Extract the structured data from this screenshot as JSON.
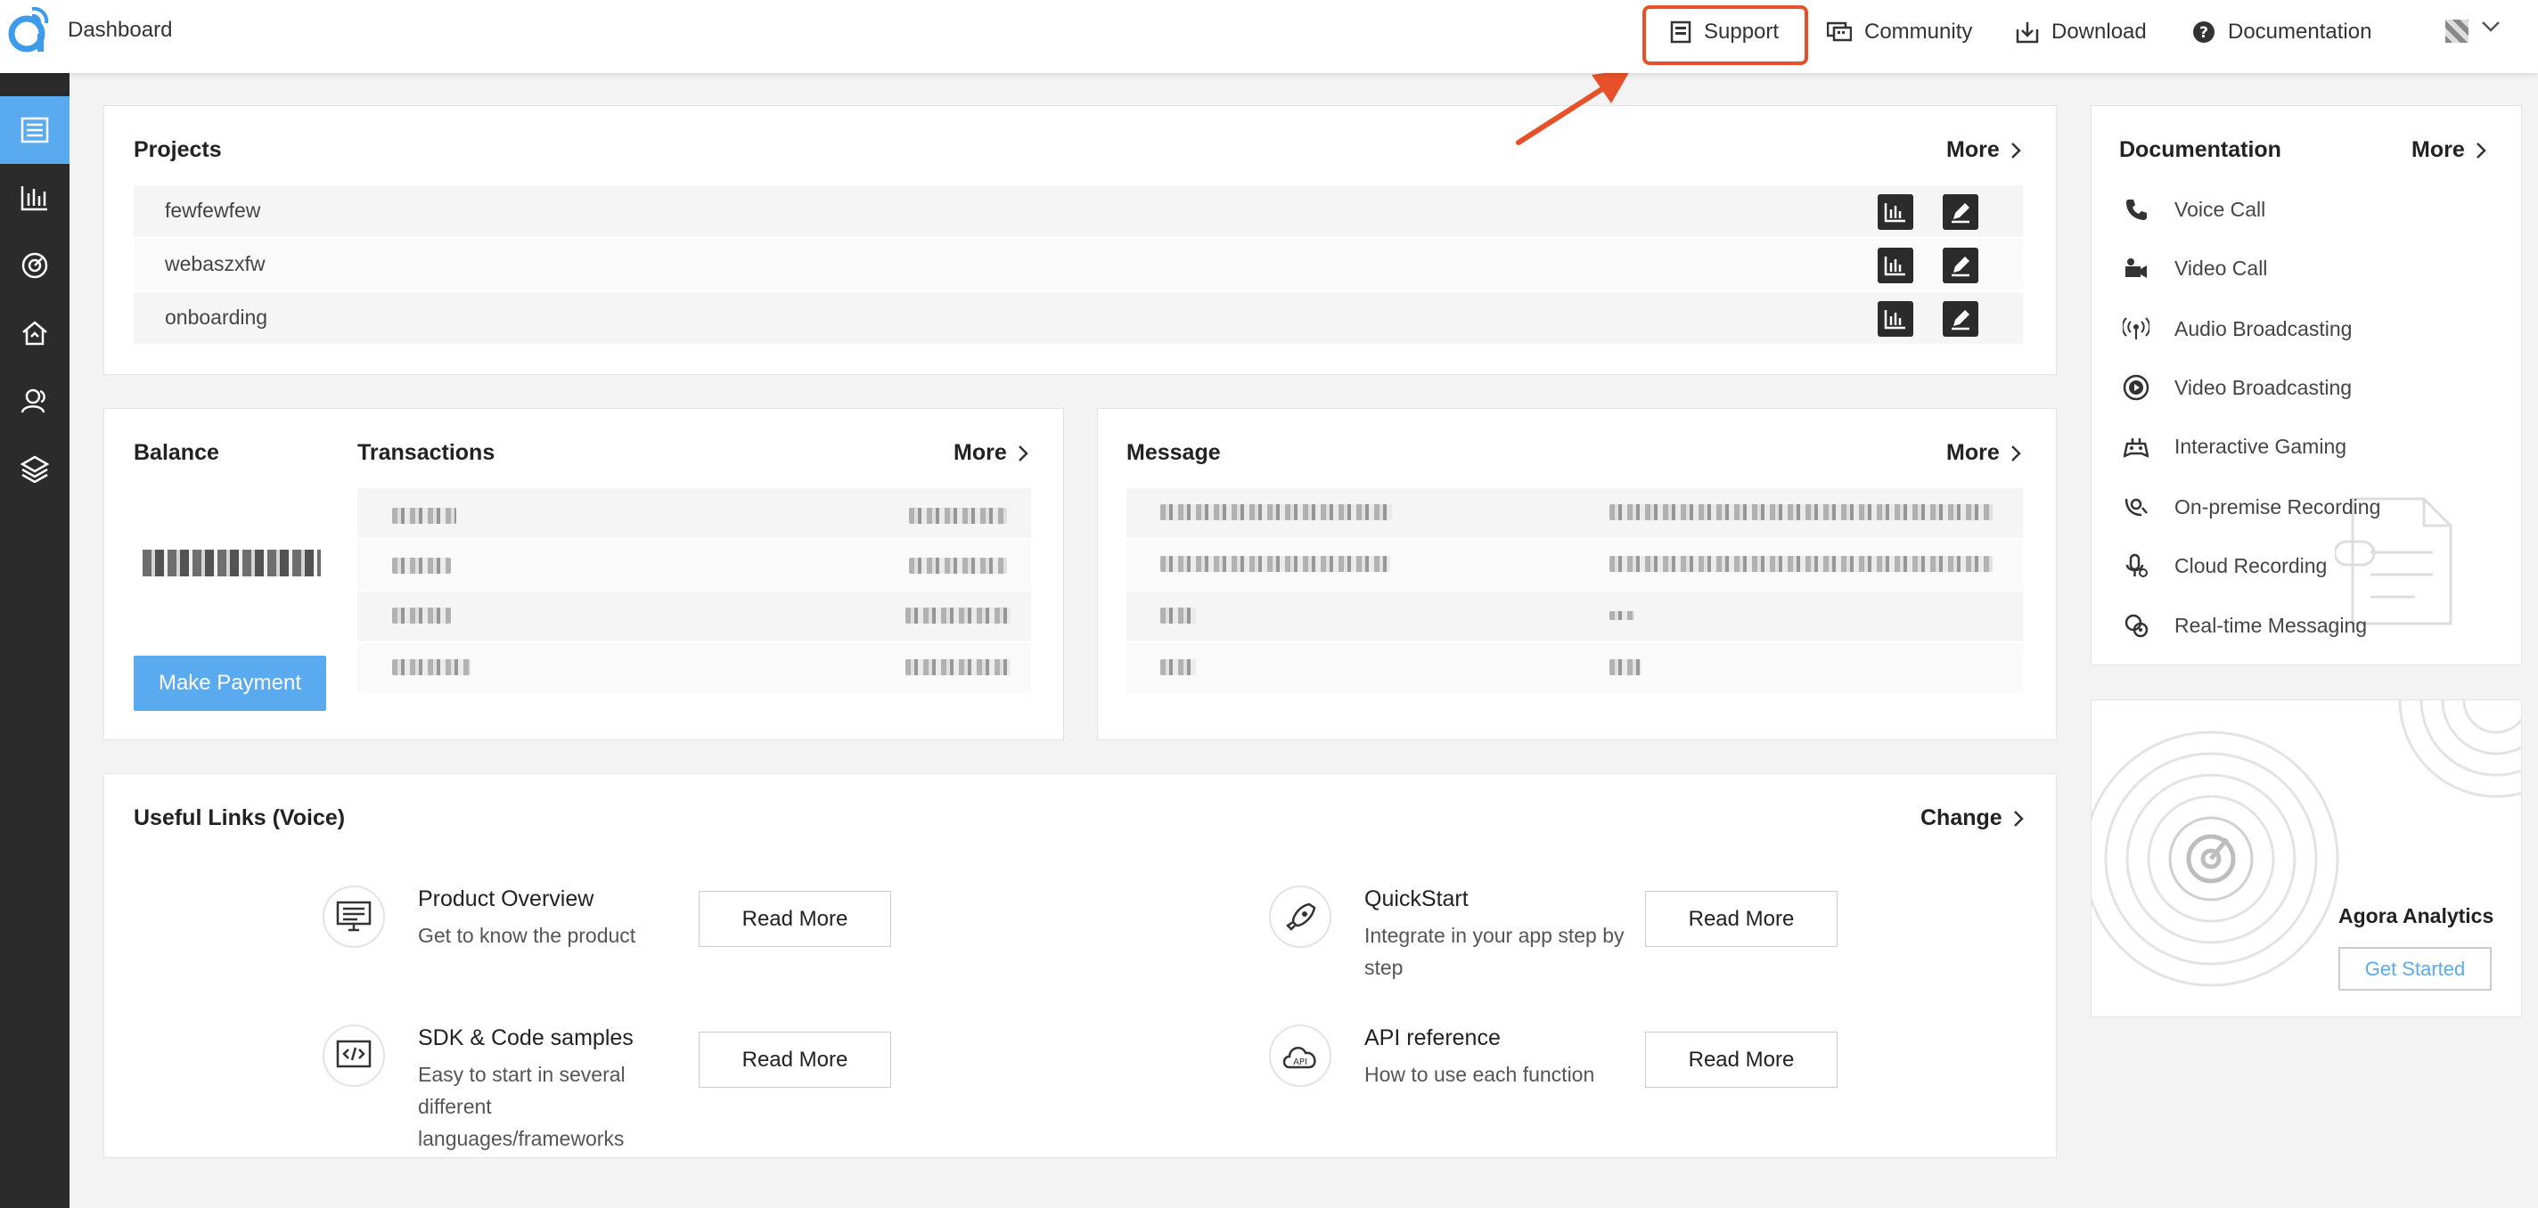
{
  "brand": "Dashboard",
  "colors": {
    "accent": "#5aaaf0",
    "highlight": "#e8502a",
    "sidebar": "#2b2b2b"
  },
  "topnav": [
    {
      "label": "Support",
      "icon": "support-icon"
    },
    {
      "label": "Community",
      "icon": "community-icon"
    },
    {
      "label": "Download",
      "icon": "download-icon"
    },
    {
      "label": "Documentation",
      "icon": "help-icon"
    }
  ],
  "sidebar": [
    "projects-icon",
    "analytics-icon",
    "monitor-icon",
    "home-icon",
    "users-icon",
    "layers-icon"
  ],
  "projects": {
    "title": "Projects",
    "more": "More",
    "items": [
      "fewfewfew",
      "webaszxfw",
      "onboarding"
    ]
  },
  "balance": {
    "title": "Balance",
    "button": "Make Payment"
  },
  "transactions": {
    "title": "Transactions",
    "more": "More"
  },
  "message": {
    "title": "Message",
    "more": "More"
  },
  "documentation": {
    "title": "Documentation",
    "more": "More",
    "items": [
      "Voice Call",
      "Video Call",
      "Audio Broadcasting",
      "Video Broadcasting",
      "Interactive Gaming",
      "On-premise Recording",
      "Cloud Recording",
      "Real-time Messaging"
    ]
  },
  "analytics": {
    "title": "Agora Analytics",
    "button": "Get Started"
  },
  "links": {
    "title": "Useful Links (Voice)",
    "change": "Change",
    "read_more": "Read More",
    "items": [
      {
        "title": "Product Overview",
        "desc": "Get to know the product"
      },
      {
        "title": "QuickStart",
        "desc": "Integrate in your app step by step"
      },
      {
        "title": "SDK & Code samples",
        "desc": "Easy to start in several different languages/frameworks"
      },
      {
        "title": "API reference",
        "desc": "How to use each function"
      }
    ]
  }
}
